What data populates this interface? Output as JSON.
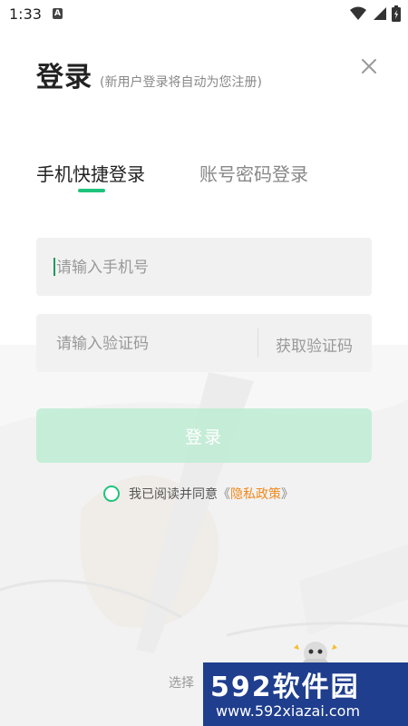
{
  "status_bar": {
    "time": "1:33",
    "notification_letter": "A"
  },
  "header": {
    "title": "登录",
    "subtitle": "(新用户登录将自动为您注册)"
  },
  "tabs": [
    {
      "label": "手机快捷登录",
      "active": true
    },
    {
      "label": "账号密码登录",
      "active": false
    }
  ],
  "form": {
    "phone_placeholder": "请输入手机号",
    "code_placeholder": "请输入验证码",
    "get_code_label": "获取验证码",
    "login_label": "登录"
  },
  "agreement": {
    "text": "我已阅读并同意",
    "open_quote": "《",
    "policy_label": "隐私政策",
    "close_quote": "》"
  },
  "footer": {
    "other_login_text": "选择"
  },
  "watermark": {
    "logo_text": "592软件园",
    "url": "www.592xiazai.com"
  },
  "colors": {
    "accent": "#1ec47c",
    "link": "#f08a1c",
    "button_disabled": "#beecd4"
  },
  "icons": {
    "close": "close-icon",
    "wifi": "wifi-icon",
    "signal": "signal-icon",
    "battery": "battery-icon"
  }
}
